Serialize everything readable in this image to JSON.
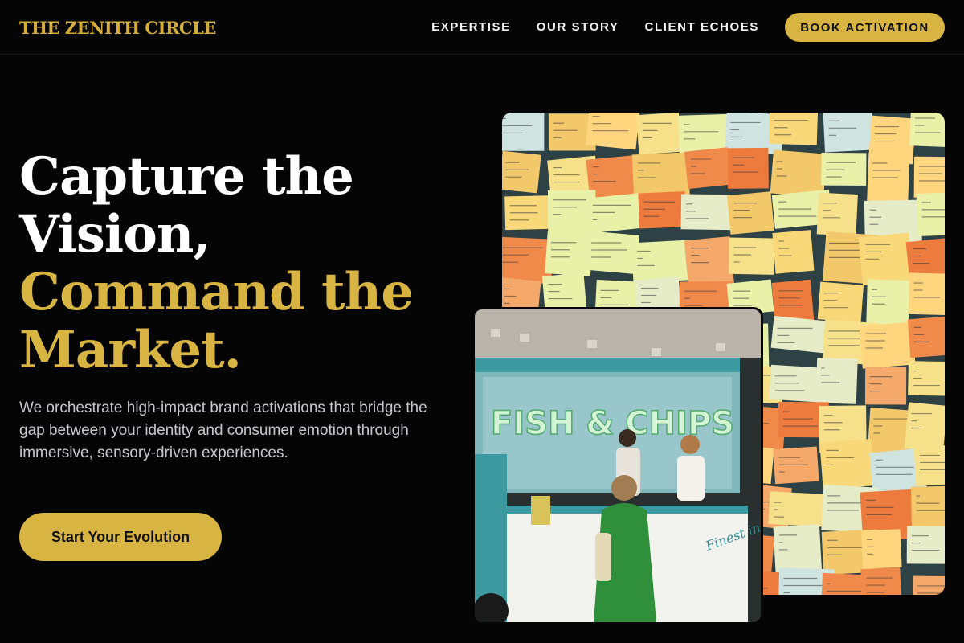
{
  "brand": {
    "logo": "THE ZENITH CIRCLE"
  },
  "nav": {
    "links": [
      "EXPERTISE",
      "OUR STORY",
      "CLIENT ECHOES"
    ],
    "cta": "BOOK ACTIVATION"
  },
  "hero": {
    "headline_white": [
      "Capture the",
      "Vision,"
    ],
    "headline_gold": [
      "Command the",
      "Market."
    ],
    "description": "We orchestrate high-impact brand activations that bridge the gap between your identity and consumer emotion through immersive, sensory-driven experiences.",
    "cta": "Start Your Evolution"
  },
  "images": {
    "notes_wall": "sticky-notes-wall-photo",
    "food_truck": "fish-and-chips-truck-photo",
    "truck_sign": "FISH & CHIPS",
    "truck_script": "Finest in London"
  },
  "colors": {
    "accent": "#d8b442",
    "background": "#050505",
    "text_muted": "#c8c8cc"
  }
}
